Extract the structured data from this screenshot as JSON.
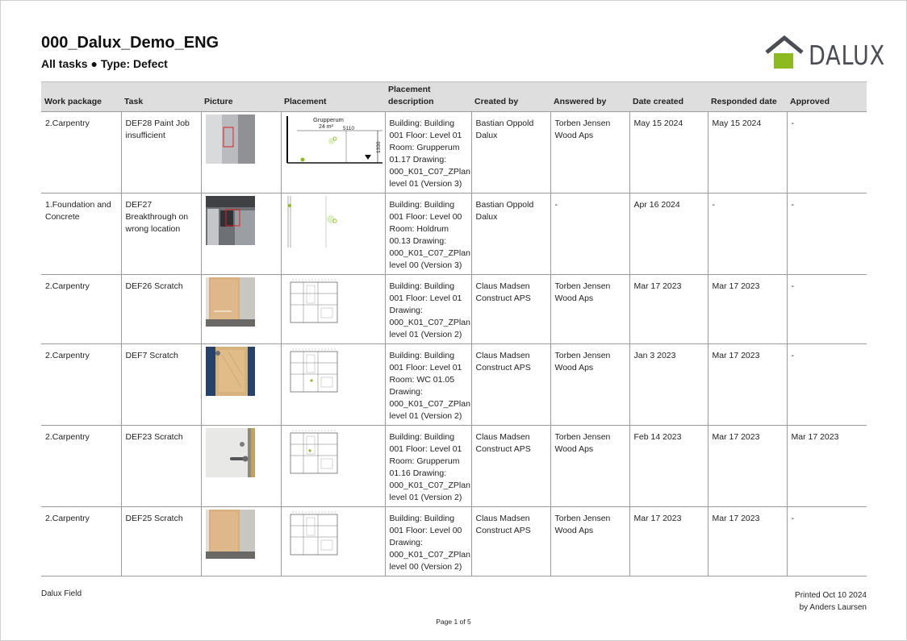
{
  "title": "000_Dalux_Demo_ENG",
  "subtitle": "All tasks ● Type: Defect",
  "logo": {
    "text": "DALUX",
    "accent_color": "#8dba1f",
    "roof_color": "#4a4d55"
  },
  "columns": [
    "Work package",
    "Task",
    "Picture",
    "Placement",
    "Placement description",
    "Created by",
    "Answered by",
    "Date created",
    "Responded date",
    "Approved"
  ],
  "rows": [
    {
      "work_package": "2.Carpentry",
      "task": "DEF28 Paint Job insufficient",
      "picture": "photo-wall-corner",
      "placement": "plan-room-grupperum",
      "plan_labels": {
        "room": "Grupperum",
        "area": "24 m²",
        "width": "5110",
        "height": "1330"
      },
      "description": "Building: Building 001 Floor: Level 01 Room: Grupperum 01.17 Drawing: 000_K01_C07_ZPlan level 01 (Version 3)",
      "created_by": "Bastian Oppold Dalux",
      "answered_by": "Torben Jensen Wood Aps",
      "date_created": "May 15 2024",
      "responded_date": "May 15 2024",
      "approved": "-"
    },
    {
      "work_package": "1.Foundation and Concrete",
      "task": "DEF27 Breakthrough on wrong location",
      "picture": "photo-ceiling-opening",
      "placement": "plan-room-holdrum",
      "description": "Building: Building 001 Floor: Level 00 Room: Holdrum 00.13 Drawing: 000_K01_C07_ZPlan level 00 (Version 3)",
      "created_by": "Bastian Oppold Dalux",
      "answered_by": "-",
      "date_created": "Apr 16 2024",
      "responded_date": "-",
      "approved": "-"
    },
    {
      "work_package": "2.Carpentry",
      "task": "DEF26 Scratch",
      "picture": "photo-door",
      "placement": "plan-floor",
      "description": "Building: Building 001 Floor: Level 01 Drawing: 000_K01_C07_ZPlan level 01 (Version 2)",
      "created_by": "Claus Madsen Construct APS",
      "answered_by": "Torben Jensen Wood Aps",
      "date_created": "Mar 17 2023",
      "responded_date": "Mar 17 2023",
      "approved": "-"
    },
    {
      "work_package": "2.Carpentry",
      "task": "DEF7 Scratch",
      "picture": "photo-wood-panel",
      "placement": "plan-floor",
      "description": "Building: Building 001 Floor: Level 01 Room: WC 01.05 Drawing: 000_K01_C07_ZPlan level 01 (Version 2)",
      "created_by": "Claus Madsen Construct APS",
      "answered_by": "Torben Jensen Wood Aps",
      "date_created": "Jan 3 2023",
      "responded_date": "Mar 17 2023",
      "approved": "-"
    },
    {
      "work_package": "2.Carpentry",
      "task": "DEF23 Scratch",
      "picture": "photo-door-handle",
      "placement": "plan-floor",
      "description": "Building: Building 001 Floor: Level 01 Room: Grupperum 01.16 Drawing: 000_K01_C07_ZPlan level 01 (Version 2)",
      "created_by": "Claus Madsen Construct APS",
      "answered_by": "Torben Jensen Wood Aps",
      "date_created": "Feb 14 2023",
      "responded_date": "Mar 17 2023",
      "approved": "Mar 17 2023"
    },
    {
      "work_package": "2.Carpentry",
      "task": "DEF25 Scratch",
      "picture": "photo-door",
      "placement": "plan-floor",
      "description": "Building: Building 001 Floor: Level 00 Drawing: 000_K01_C07_ZPlan level 00 (Version 2)",
      "created_by": "Claus Madsen Construct APS",
      "answered_by": "Torben Jensen Wood Aps",
      "date_created": "Mar 17 2023",
      "responded_date": "Mar 17 2023",
      "approved": "-"
    }
  ],
  "footer": {
    "app": "Dalux Field",
    "printed": "Printed Oct 10 2024",
    "printed_by": "by Anders Laursen",
    "page": "Page 1 of 5"
  }
}
